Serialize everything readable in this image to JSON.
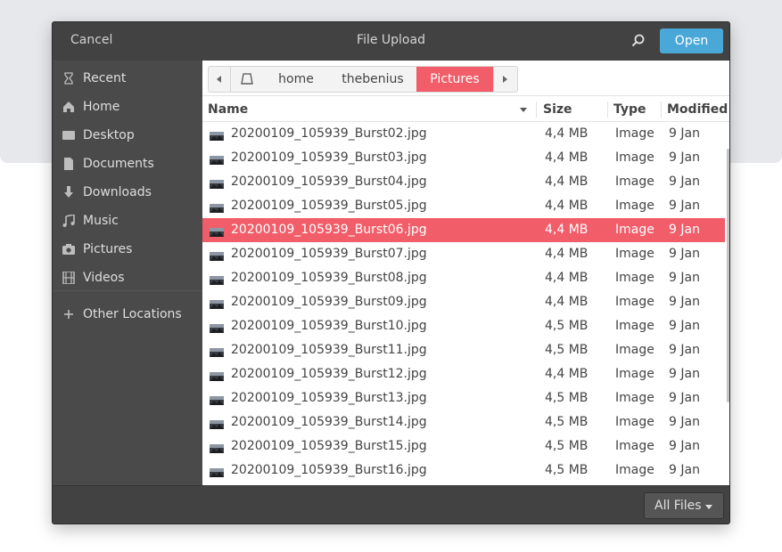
{
  "header": {
    "cancel_label": "Cancel",
    "title": "File Upload",
    "search_icon": "search-icon",
    "open_label": "Open",
    "accent": "#4aa8d8"
  },
  "sidebar": {
    "items": [
      {
        "label": "Recent",
        "icon": "clock-icon"
      },
      {
        "label": "Home",
        "icon": "home-icon"
      },
      {
        "label": "Desktop",
        "icon": "desktop-icon"
      },
      {
        "label": "Documents",
        "icon": "document-icon"
      },
      {
        "label": "Downloads",
        "icon": "download-icon"
      },
      {
        "label": "Music",
        "icon": "music-icon"
      },
      {
        "label": "Pictures",
        "icon": "camera-icon"
      },
      {
        "label": "Videos",
        "icon": "film-icon"
      }
    ],
    "other_locations": {
      "label": "Other Locations",
      "icon": "plus-icon"
    }
  },
  "pathbar": {
    "segments": [
      "home",
      "thebenius",
      "Pictures"
    ],
    "active_index": 2,
    "highlight": "#f15d69"
  },
  "columns": {
    "name": "Name",
    "size": "Size",
    "type": "Type",
    "modified": "Modified"
  },
  "files": [
    {
      "name": "20200109_105939_Burst02.jpg",
      "size": "4,4 MB",
      "type": "Image",
      "modified": "9 Jan",
      "selected": false
    },
    {
      "name": "20200109_105939_Burst03.jpg",
      "size": "4,4 MB",
      "type": "Image",
      "modified": "9 Jan",
      "selected": false
    },
    {
      "name": "20200109_105939_Burst04.jpg",
      "size": "4,4 MB",
      "type": "Image",
      "modified": "9 Jan",
      "selected": false
    },
    {
      "name": "20200109_105939_Burst05.jpg",
      "size": "4,4 MB",
      "type": "Image",
      "modified": "9 Jan",
      "selected": false
    },
    {
      "name": "20200109_105939_Burst06.jpg",
      "size": "4,4 MB",
      "type": "Image",
      "modified": "9 Jan",
      "selected": true
    },
    {
      "name": "20200109_105939_Burst07.jpg",
      "size": "4,4 MB",
      "type": "Image",
      "modified": "9 Jan",
      "selected": false
    },
    {
      "name": "20200109_105939_Burst08.jpg",
      "size": "4,4 MB",
      "type": "Image",
      "modified": "9 Jan",
      "selected": false
    },
    {
      "name": "20200109_105939_Burst09.jpg",
      "size": "4,4 MB",
      "type": "Image",
      "modified": "9 Jan",
      "selected": false
    },
    {
      "name": "20200109_105939_Burst10.jpg",
      "size": "4,5 MB",
      "type": "Image",
      "modified": "9 Jan",
      "selected": false
    },
    {
      "name": "20200109_105939_Burst11.jpg",
      "size": "4,5 MB",
      "type": "Image",
      "modified": "9 Jan",
      "selected": false
    },
    {
      "name": "20200109_105939_Burst12.jpg",
      "size": "4,4 MB",
      "type": "Image",
      "modified": "9 Jan",
      "selected": false
    },
    {
      "name": "20200109_105939_Burst13.jpg",
      "size": "4,5 MB",
      "type": "Image",
      "modified": "9 Jan",
      "selected": false
    },
    {
      "name": "20200109_105939_Burst14.jpg",
      "size": "4,5 MB",
      "type": "Image",
      "modified": "9 Jan",
      "selected": false
    },
    {
      "name": "20200109_105939_Burst15.jpg",
      "size": "4,5 MB",
      "type": "Image",
      "modified": "9 Jan",
      "selected": false
    },
    {
      "name": "20200109_105939_Burst16.jpg",
      "size": "4,5 MB",
      "type": "Image",
      "modified": "9 Jan",
      "selected": false
    }
  ],
  "footer": {
    "filter_label": "All Files"
  }
}
